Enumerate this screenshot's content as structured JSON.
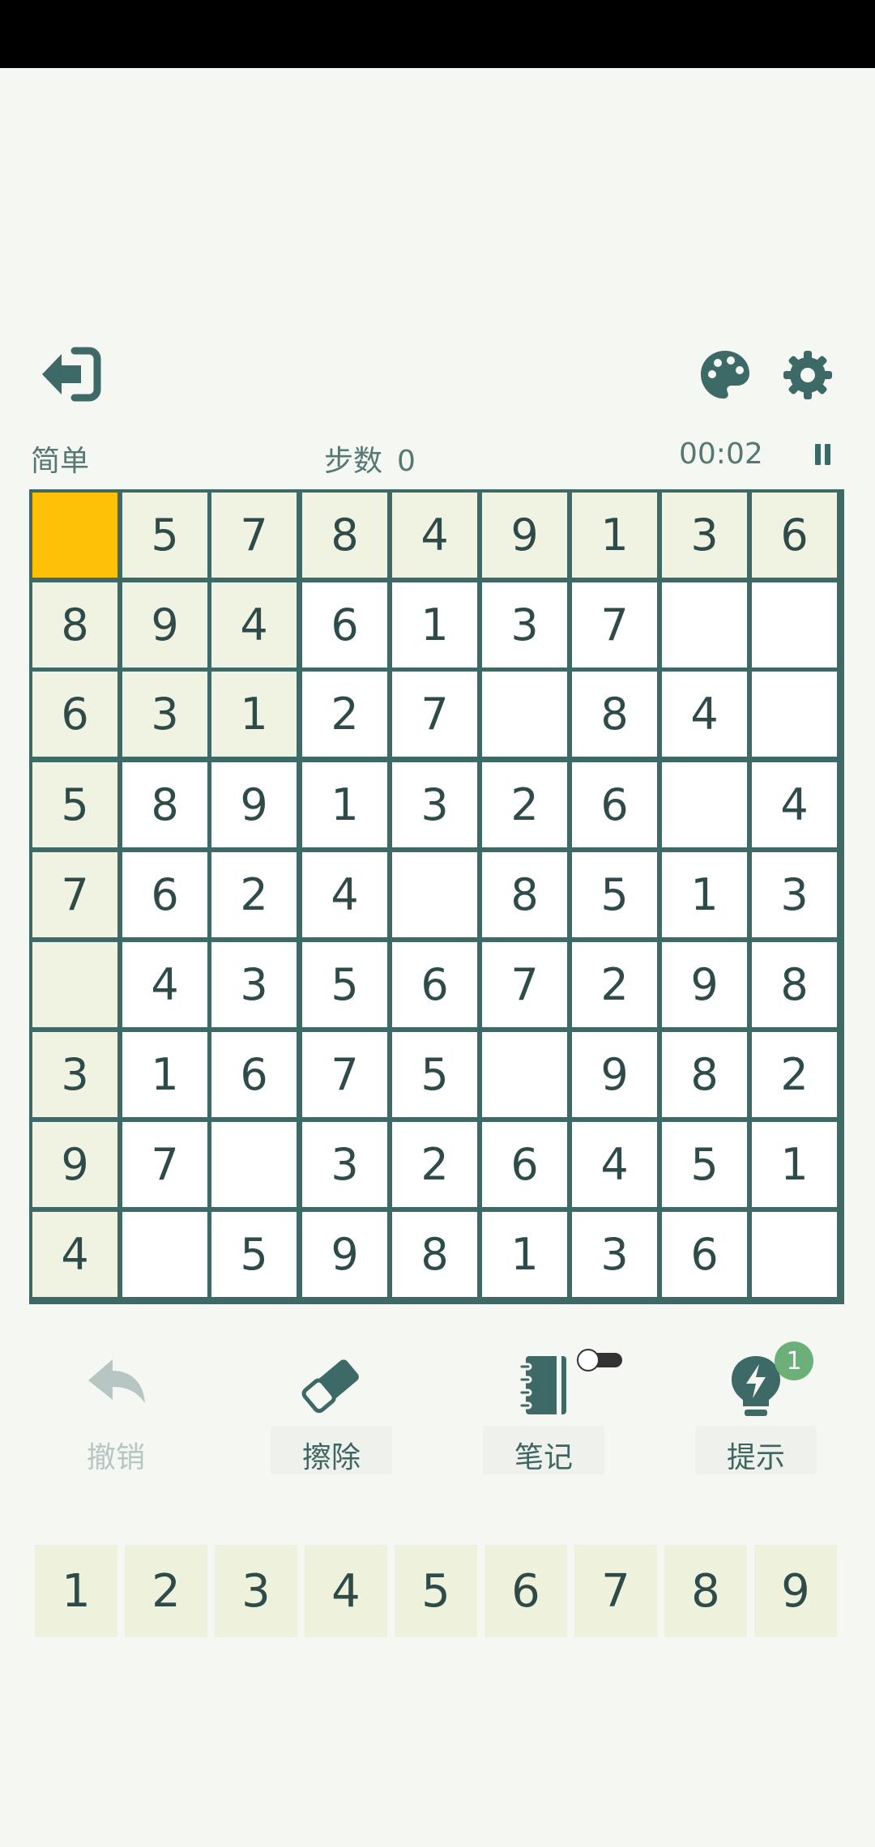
{
  "header": {
    "exit_icon": "exit-arrow-icon",
    "theme_icon": "palette-icon",
    "settings_icon": "gear-icon"
  },
  "info": {
    "difficulty": "简单",
    "steps_label": "步数",
    "steps_value": "0",
    "timer": "00:02"
  },
  "board": {
    "grid": [
      [
        0,
        5,
        7,
        8,
        4,
        9,
        1,
        3,
        6
      ],
      [
        8,
        9,
        4,
        6,
        1,
        3,
        7,
        0,
        0
      ],
      [
        6,
        3,
        1,
        2,
        7,
        0,
        8,
        4,
        0
      ],
      [
        5,
        8,
        9,
        1,
        3,
        2,
        6,
        0,
        4
      ],
      [
        7,
        6,
        2,
        4,
        0,
        8,
        5,
        1,
        3
      ],
      [
        0,
        4,
        3,
        5,
        6,
        7,
        2,
        9,
        8
      ],
      [
        3,
        1,
        6,
        7,
        5,
        0,
        9,
        8,
        2
      ],
      [
        9,
        7,
        0,
        3,
        2,
        6,
        4,
        5,
        1
      ],
      [
        4,
        0,
        5,
        9,
        8,
        1,
        3,
        6,
        0
      ]
    ],
    "selected": [
      0,
      0
    ],
    "colors": {
      "selected": "#ffc107",
      "highlight": "#f0f3e1",
      "cell": "#ffffff",
      "grid_line": "#3d6a67"
    }
  },
  "tools": {
    "undo": {
      "label": "撤销",
      "icon": "undo-arrow-icon",
      "enabled": false
    },
    "erase": {
      "label": "擦除",
      "icon": "eraser-icon",
      "enabled": true
    },
    "notes": {
      "label": "笔记",
      "icon": "notebook-icon",
      "toggle_on": false
    },
    "hint": {
      "label": "提示",
      "icon": "lightbulb-icon",
      "badge": "1"
    }
  },
  "numpad": [
    "1",
    "2",
    "3",
    "4",
    "5",
    "6",
    "7",
    "8",
    "9"
  ]
}
